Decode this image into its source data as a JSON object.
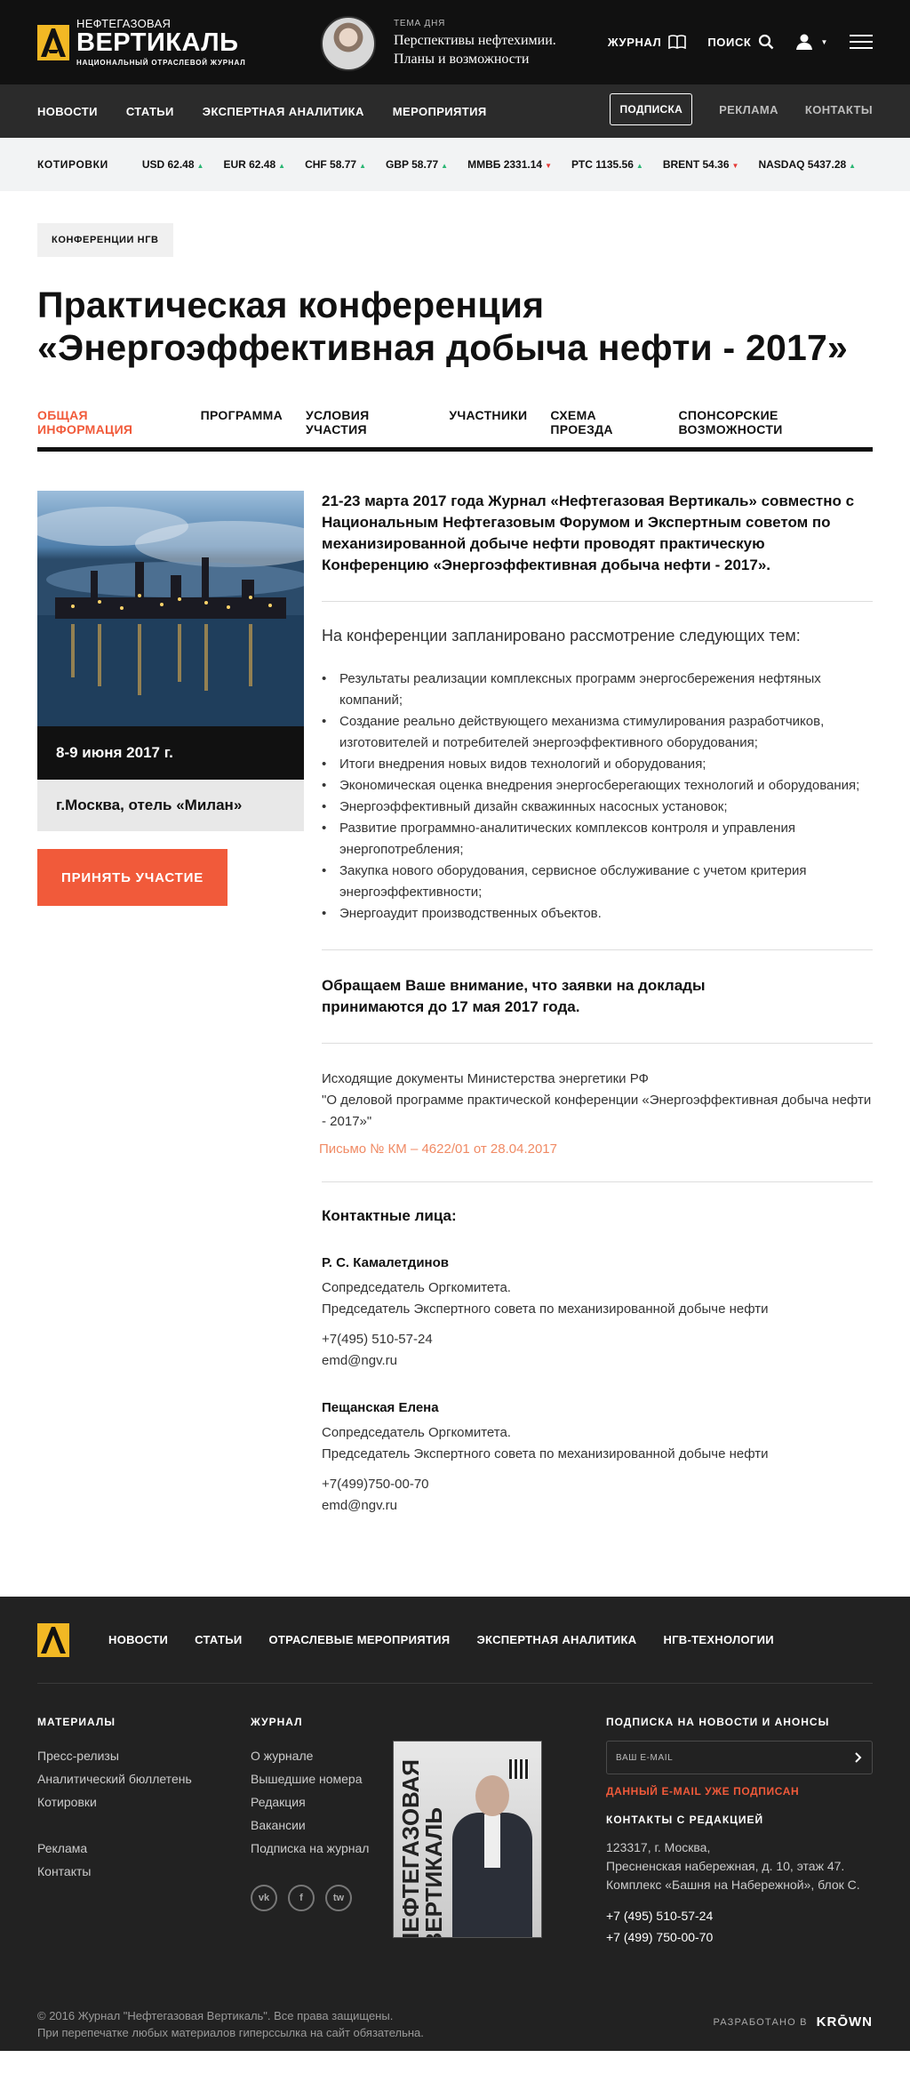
{
  "header": {
    "logo_small": "НЕФТЕГАЗОВАЯ",
    "logo_big": "ВЕРТИКАЛЬ",
    "logo_sub": "НАЦИОНАЛЬНЫЙ ОТРАСЛЕВОЙ ЖУРНАЛ",
    "topic_label": "ТЕМА ДНЯ",
    "topic_title": "Перспективы нефтехимии. Планы и возможности",
    "journal": "ЖУРНАЛ",
    "search": "ПОИСК"
  },
  "nav": {
    "items": [
      "НОВОСТИ",
      "СТАТЬИ",
      "ЭКСПЕРТНАЯ АНАЛИТИКА",
      "МЕРОПРИЯТИЯ"
    ],
    "subscribe": "ПОДПИСКА",
    "ads": "РЕКЛАМА",
    "contacts": "КОНТАКТЫ"
  },
  "quotes": {
    "label": "КОТИРОВКИ",
    "items": [
      {
        "text": "USD 62.48",
        "dir": "up"
      },
      {
        "text": "EUR 62.48",
        "dir": "up"
      },
      {
        "text": "CHF 58.77",
        "dir": "up"
      },
      {
        "text": "GBP 58.77",
        "dir": "up"
      },
      {
        "text": "ММВБ 2331.14",
        "dir": "down"
      },
      {
        "text": "РТС 1135.56",
        "dir": "up"
      },
      {
        "text": "BRENT 54.36",
        "dir": "down"
      },
      {
        "text": "NASDAQ 5437.28",
        "dir": "up"
      }
    ]
  },
  "page": {
    "tag": "КОНФЕРЕНЦИИ НГВ",
    "title_line1": "Практическая конференция",
    "title_line2": "«Энергоэффективная добыча нефти - 2017»",
    "tabs": [
      "ОБЩАЯ ИНФОРМАЦИЯ",
      "ПРОГРАММА",
      "УСЛОВИЯ УЧАСТИЯ",
      "УЧАСТНИКИ",
      "СХЕМА ПРОЕЗДА",
      "СПОНСОРСКИЕ ВОЗМОЖНОСТИ"
    ],
    "date": "8-9 июня 2017 г.",
    "place": "г.Москва, отель «Милан»",
    "join": "ПРИНЯТЬ УЧАСТИЕ",
    "lead": "21-23 марта 2017 года Журнал «Нефтегазовая Вертикаль» совместно с Национальным Нефтегазовым Форумом и Экспертным советом по механизированной добыче нефти проводят практическую Конференцию «Энергоэффективная добыча нефти - 2017».",
    "intro": "На конференции запланировано рассмотрение следующих тем:",
    "topics": [
      "Результаты реализации комплексных программ энергосбережения нефтяных компаний;",
      "Создание реально действующего механизма стимулирования разработчиков, изготовителей и потребителей энергоэффективного оборудования;",
      "Итоги внедрения новых видов технологий и оборудования;",
      "Экономическая оценка внедрения энергосберегающих технологий и оборудования;",
      "Энергоэффективный дизайн скважинных насосных установок;",
      "Развитие программно-аналитических комплексов контроля и управления энергопотребления;",
      "Закупка нового оборудования, сервисное обслуживание с учетом критерия энергоэффективности;",
      "Энергоаудит производственных объектов."
    ],
    "notice_line1": "Обращаем Ваше внимание, что заявки на доклады",
    "notice_line2": "принимаются  до 17 мая 2017 года.",
    "docs_line1": "Исходящие документы Министерства энергетики РФ",
    "docs_line2": "\"О деловой программе практической конференции «Энергоэффективная добыча нефти - 2017»\"",
    "doc_link": "Письмо № КМ – 4622/01 от 28.04.2017",
    "contacts_title": "Контактные лица:",
    "persons": [
      {
        "name": "Р. С. Камалетдинов",
        "role1": "Сопредседатель Оргкомитета.",
        "role2": "Председатель Экспертного совета по механизированной добыче нефти",
        "phone": "+7(495) 510-57-24",
        "email": "emd@ngv.ru"
      },
      {
        "name": "Пещанская Елена",
        "role1": "Сопредседатель Оргкомитета.",
        "role2": "Председатель Экспертного совета по механизированной добыче нефти",
        "phone": "+7(499)750-00-70",
        "email": "emd@ngv.ru"
      }
    ]
  },
  "footer": {
    "nav": [
      "НОВОСТИ",
      "СТАТЬИ",
      "ОТРАСЛЕВЫЕ МЕРОПРИЯТИЯ",
      "ЭКСПЕРТНАЯ АНАЛИТИКА",
      "НГВ-ТЕХНОЛОГИИ"
    ],
    "materials_title": "МАТЕРИАЛЫ",
    "materials": [
      "Пресс-релизы",
      "Аналитический бюллетень",
      "Котировки"
    ],
    "materials2": [
      "Реклама",
      "Контакты"
    ],
    "journal_title": "ЖУРНАЛ",
    "journal": [
      "О журнале",
      "Вышедшие номера",
      "Редакция",
      "Вакансии",
      "Подписка на журнал"
    ],
    "socials": [
      "vk",
      "f",
      "tw"
    ],
    "magazine_title": "НЕФТЕГАЗОВАЯ ВЕРТИКАЛЬ",
    "subscribe_title": "ПОДПИСКА НА НОВОСТИ И АНОНСЫ",
    "email_placeholder": "ВАШ E-MAIL",
    "subscribed": "ДАННЫЙ E-MAIL УЖЕ ПОДПИСАН",
    "contacts_title": "КОНТАКТЫ С РЕДАКЦИЕЙ",
    "address1": "123317, г. Москва,",
    "address2": "Пресненская набережная, д. 10, этаж 47.",
    "address3": "Комплекс «Башня на Набережной», блок С.",
    "phone1": "+7 (495) 510-57-24",
    "phone2": "+7 (499) 750-00-70",
    "copyright1": "© 2016 Журнал \"Нефтегазовая Вертикаль\". Все права защищены.",
    "copyright2": "При перепечатке любых материалов гиперссылка на сайт обязательна.",
    "credit_label": "РАЗРАБОТАНО В",
    "credit_brand": "KRŌWN"
  },
  "colors": {
    "accent": "#f15a3a",
    "brand": "#f2b824",
    "dark": "#111111"
  }
}
